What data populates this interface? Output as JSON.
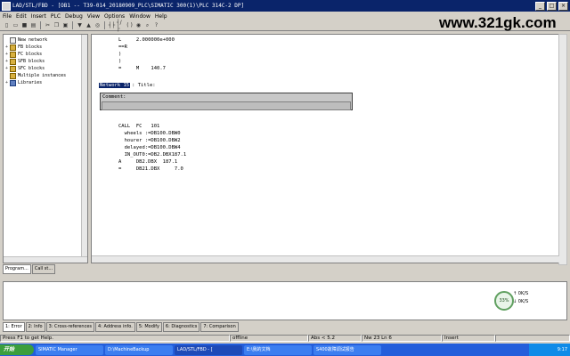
{
  "window": {
    "title": "LAD/STL/FBD  - [OB1 -- T39-014_20180909_PLC\\SIMATIC 300(1)\\PLC 314C-2 DP]",
    "min": "_",
    "max": "□",
    "close": "×"
  },
  "menu": [
    "File",
    "Edit",
    "Insert",
    "PLC",
    "Debug",
    "View",
    "Options",
    "Window",
    "Help"
  ],
  "watermark": "www.321gk.com",
  "tree": [
    {
      "label": "New network",
      "expander": ""
    },
    {
      "label": "FB blocks",
      "expander": "+"
    },
    {
      "label": "FC blocks",
      "expander": "+"
    },
    {
      "label": "SFB blocks",
      "expander": "+"
    },
    {
      "label": "SFC blocks",
      "expander": "+"
    },
    {
      "label": "Multiple instances",
      "expander": ""
    },
    {
      "label": "Libraries",
      "expander": "+"
    }
  ],
  "left_tabs": [
    "Program...",
    "Call st..."
  ],
  "editor": {
    "code_top": "L     2.000000e+000\n==R\n)\n)\n=     M    140.7",
    "network_number": "Network 15",
    "network_title": ": Title:",
    "comment_label": "Comment:",
    "code_bottom": "CALL  FC   101\n  wheels :=DB100.DBW0\n  hourer :=DB100.DBW2\n  delayed:=DB100.DBW4\n  IN_OUT0:=DB2.DBX187.1\nA     DB2.DBX  187.1\n=     DB21.DBX     7.0"
  },
  "monitor": {
    "percent": "33%",
    "line1": "0K/S",
    "line2": "0K/S",
    "up_arrow": "↑",
    "down_arrow": "↓"
  },
  "bottom_tabs": [
    "1: Error",
    "2: Info",
    "3: Cross-references",
    "4: Address info.",
    "5: Modify",
    "6: Diagnostics",
    "7: Comparison"
  ],
  "status": {
    "help": "Press F1 to get Help.",
    "mode": "offline",
    "abs": "Abs < 5.2",
    "pos": "Nw 23  Ln  6",
    "insert": "Insert"
  },
  "taskbar": {
    "start": "开始",
    "tasks": [
      "SIMATIC Manager",
      "D:\\MachineBackup",
      "LAD/STL/FBD - [",
      "E:\\我的文档",
      "S400故障调试报告"
    ],
    "clock": "9:17"
  },
  "colors": {
    "titlebar": "#0a246a",
    "taskbar": "#245edb",
    "window_bg": "#d4d0c8"
  }
}
